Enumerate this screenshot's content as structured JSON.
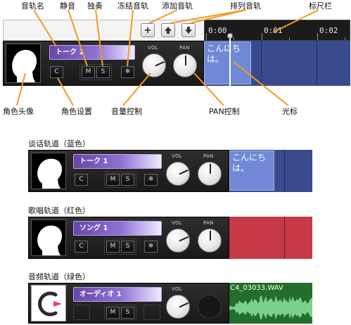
{
  "callouts": {
    "track_name": "音轨名",
    "mute": "静音",
    "solo": "独奏",
    "freeze_track": "冻结音轨",
    "add_track": "添加音轨",
    "arrange_track": "排列音轨",
    "ruler": "标尺栏",
    "character_avatar": "角色头像",
    "character_settings": "角色设置",
    "volume_control": "音量控制",
    "pan_control": "PAN控制",
    "cursor": "光标"
  },
  "toolbar": {
    "add_label": "+",
    "up_label": "🡅",
    "down_label": "🡇"
  },
  "ruler": {
    "labels": [
      "0:00",
      "0:01",
      "0:02"
    ]
  },
  "knob_labels": {
    "vol": "VOL",
    "pan": "PAN"
  },
  "buttons": {
    "character": "C",
    "mute": "M",
    "solo": "S",
    "freeze": "❄"
  },
  "top_track": {
    "name": "トーク 1",
    "clip_text": "こんにち\nは。"
  },
  "sections": [
    {
      "title": "谈话轨道（蓝色）",
      "track_name": "トーク 1",
      "clip_text": "こんにち\nは。",
      "color": "#3a4a8e"
    },
    {
      "title": "歌唱轨道（红色）",
      "track_name": "ソング 1",
      "clip_text": "",
      "color": "#c63a47"
    },
    {
      "title": "音频轨道（绿色）",
      "track_name": "オーディオ 1",
      "clip_text": "C4_03033.WAV",
      "color": "#236e2b"
    }
  ]
}
